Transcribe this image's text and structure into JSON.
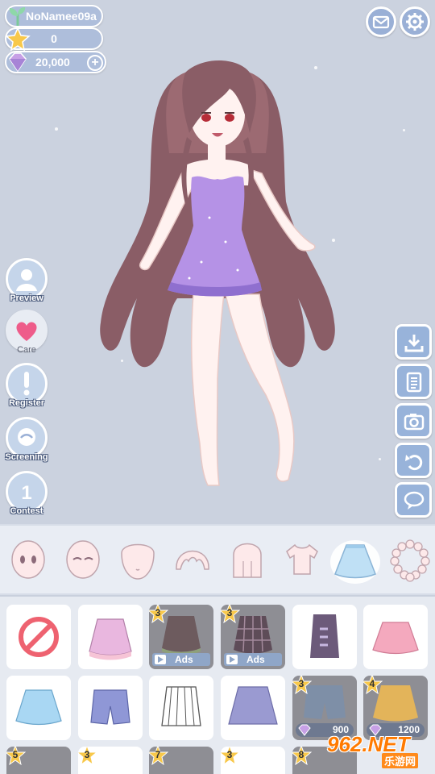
{
  "player": {
    "name": "NoNamee09a",
    "stars": "0",
    "gems": "20,000",
    "add_label": "+"
  },
  "top_buttons": [
    "mail-icon",
    "gear-icon"
  ],
  "side_menu": [
    {
      "label": "Preview",
      "icon": "preview-icon"
    },
    {
      "label": "Care",
      "icon": "heart-icon"
    },
    {
      "label": "Register",
      "icon": "exclamation-icon"
    },
    {
      "label": "Screening",
      "icon": "screening-icon"
    },
    {
      "label": "Contest",
      "icon": "trophy-icon"
    }
  ],
  "tools": [
    "download-icon",
    "clipboard-icon",
    "camera-icon",
    "undo-icon",
    "chat-icon"
  ],
  "categories": [
    {
      "name": "eyes",
      "icon": "eyes-icon"
    },
    {
      "name": "closed-eyes",
      "icon": "closed-eyes-icon"
    },
    {
      "name": "face",
      "icon": "face-icon"
    },
    {
      "name": "bangs",
      "icon": "bangs-hair-icon"
    },
    {
      "name": "hair",
      "icon": "back-hair-icon"
    },
    {
      "name": "top",
      "icon": "tshirt-icon"
    },
    {
      "name": "skirt",
      "icon": "skirt-icon",
      "active": true
    },
    {
      "name": "accessory",
      "icon": "necklace-icon"
    }
  ],
  "items": [
    {
      "type": "none"
    },
    {
      "type": "skirt",
      "color": "#e9b7df"
    },
    {
      "type": "skirt",
      "level": "3",
      "ads": "Ads",
      "color": "#7c6a6a"
    },
    {
      "type": "skirt",
      "level": "3",
      "ads": "Ads",
      "color": "#6a5a66"
    },
    {
      "type": "skirt",
      "color": "#6c5a7a"
    },
    {
      "type": "skirt",
      "color": "#f4a9be"
    },
    {
      "type": "skirt",
      "color": "#a9d7f3"
    },
    {
      "type": "shorts",
      "color": "#8f97d6"
    },
    {
      "type": "skirt",
      "color": "#ffffff"
    },
    {
      "type": "skirt",
      "color": "#9a9ad1"
    },
    {
      "type": "shorts",
      "level": "3",
      "price": "900",
      "color": "#7e8fa7"
    },
    {
      "type": "skirt",
      "level": "4",
      "price": "1200",
      "color": "#f3cf7a"
    },
    {
      "type": "skirt",
      "level": "5",
      "color": "#6b6f86"
    },
    {
      "type": "skirt",
      "level": "3",
      "color": "#eeeeee"
    },
    {
      "type": "skirt",
      "level": "7",
      "color": "#7a6b8d"
    },
    {
      "type": "skirt",
      "level": "3",
      "color": "#eeeeee"
    },
    {
      "type": "skirt",
      "level": "8",
      "color": "#e19a4a"
    }
  ],
  "watermark": {
    "brand": "962.NET",
    "sub": "乐游网"
  },
  "colors": {
    "accent": "#98b3da",
    "gem": "#c7a0e6",
    "star": "#f8c84a"
  }
}
